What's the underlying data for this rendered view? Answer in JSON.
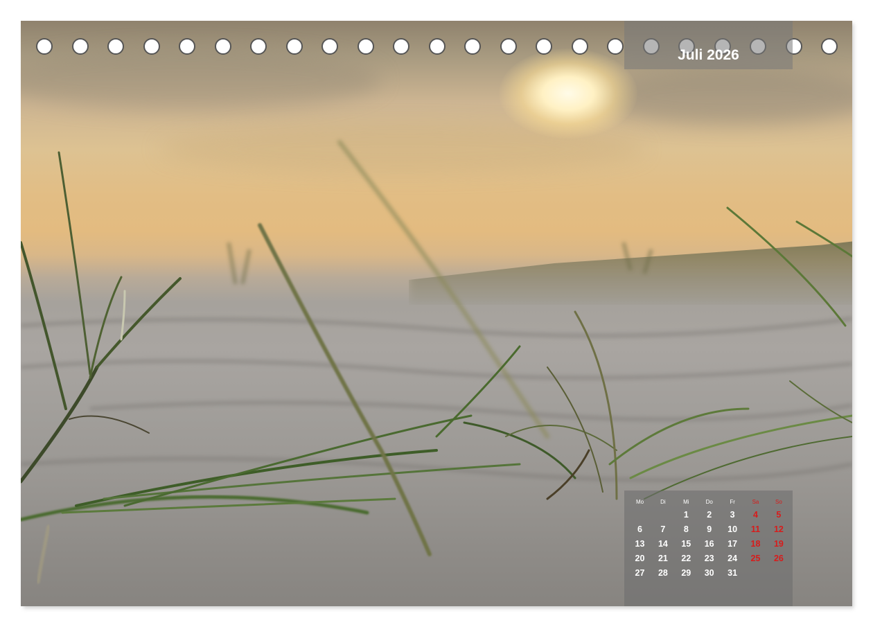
{
  "calendar": {
    "month_title": "Juli 2026",
    "weekdays": [
      "Mo",
      "Di",
      "Mi",
      "Do",
      "Fr",
      "Sa",
      "So"
    ],
    "weeks": [
      [
        "",
        "",
        "1",
        "2",
        "3",
        "4",
        "5"
      ],
      [
        "6",
        "7",
        "8",
        "9",
        "10",
        "11",
        "12"
      ],
      [
        "13",
        "14",
        "15",
        "16",
        "17",
        "18",
        "19"
      ],
      [
        "20",
        "21",
        "22",
        "23",
        "24",
        "25",
        "26"
      ],
      [
        "27",
        "28",
        "29",
        "30",
        "31",
        "",
        ""
      ]
    ],
    "weekend_color": "#d81b1b"
  },
  "binding": {
    "ring_count": 23
  },
  "photo": {
    "subject": "beach-grass-sunset"
  }
}
